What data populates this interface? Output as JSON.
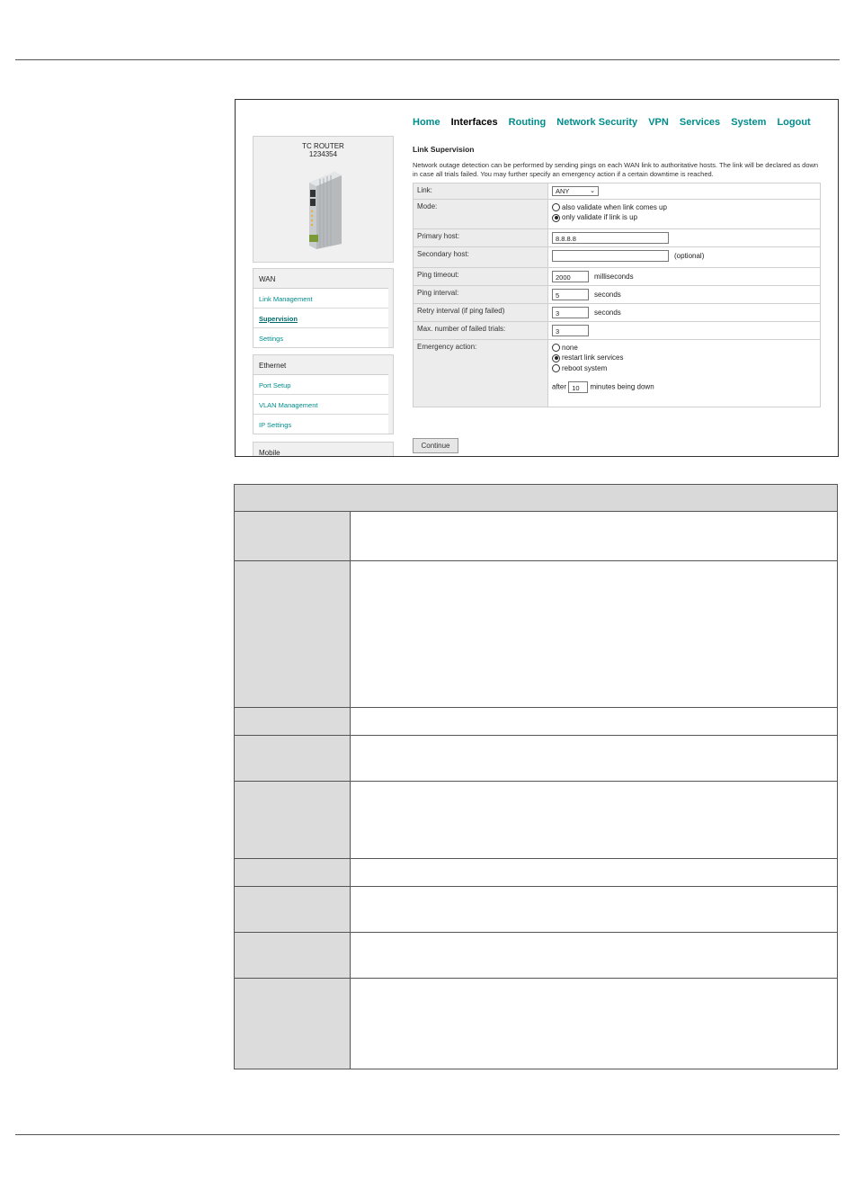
{
  "nav": [
    "Home",
    "Interfaces",
    "Routing",
    "Network Security",
    "VPN",
    "Services",
    "System",
    "Logout"
  ],
  "nav_active": "Interfaces",
  "device": {
    "name": "TC ROUTER",
    "number": "1234354"
  },
  "menu": {
    "wan": {
      "header": "WAN",
      "items": [
        "Link Management",
        "Supervision",
        "Settings"
      ],
      "selected": "Supervision"
    },
    "ethernet": {
      "header": "Ethernet",
      "items": [
        "Port Setup",
        "VLAN Management",
        "IP Settings"
      ]
    },
    "mobile": {
      "header": "Mobile"
    }
  },
  "section": {
    "title": "Link Supervision",
    "description": "Network outage detection can be performed by sending pings on each WAN link to authoritative hosts. The link will be declared as down in case all trials failed. You may further specify an emergency action if a certain downtime is reached."
  },
  "form": {
    "link": {
      "label": "Link:",
      "value": "ANY"
    },
    "mode": {
      "label": "Mode:",
      "options": [
        "also validate when link comes up",
        "only validate if link is up"
      ],
      "selected": 1
    },
    "primary_host": {
      "label": "Primary host:",
      "value": "8.8.8.8"
    },
    "secondary_host": {
      "label": "Secondary host:",
      "value": "",
      "hint": "(optional)"
    },
    "ping_timeout": {
      "label": "Ping timeout:",
      "value": "2000",
      "unit": "milliseconds"
    },
    "ping_interval": {
      "label": "Ping interval:",
      "value": "5",
      "unit": "seconds"
    },
    "retry_interval": {
      "label": "Retry interval (if ping failed)",
      "value": "3",
      "unit": "seconds"
    },
    "max_failed": {
      "label": "Max. number of failed trials:",
      "value": "3"
    },
    "emergency": {
      "label": "Emergency action:",
      "options": [
        "none",
        "restart link services",
        "reboot system"
      ],
      "selected": 1,
      "after_prefix": "after",
      "after_value": "10",
      "after_suffix": "minutes being down"
    }
  },
  "continue_label": "Continue"
}
